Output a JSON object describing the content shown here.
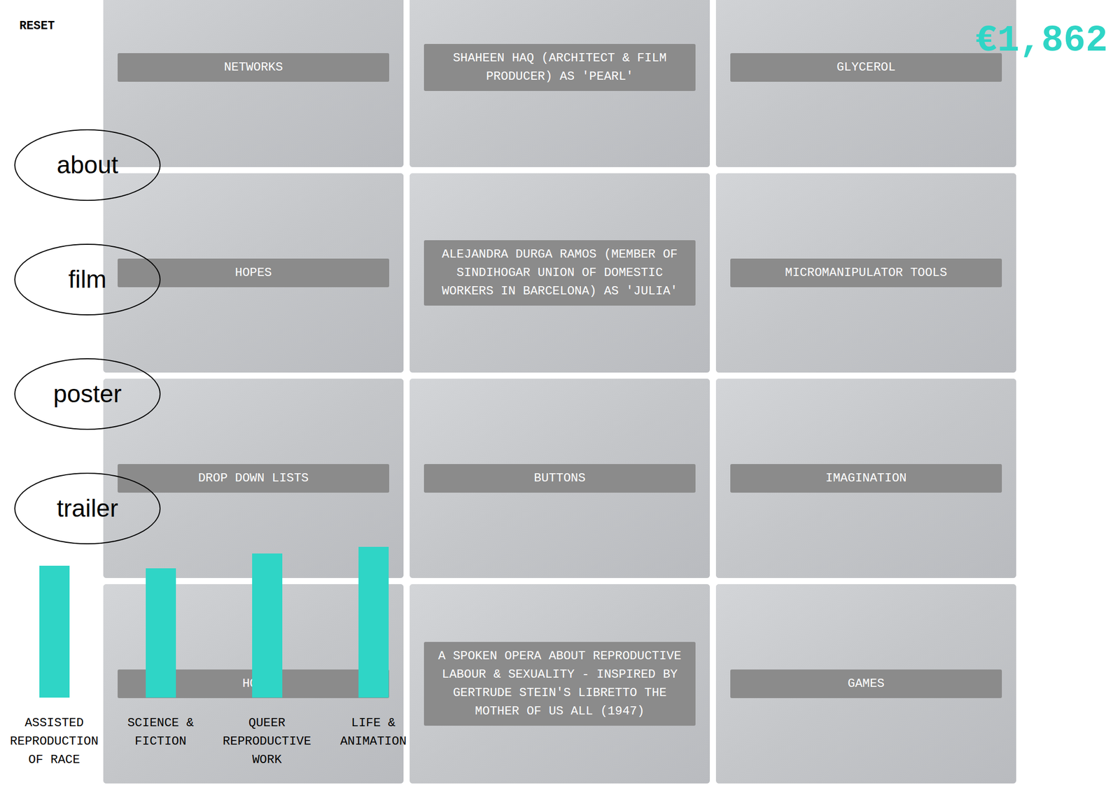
{
  "reset": "RESET",
  "price": "€1,862",
  "nav": [
    {
      "label": "about"
    },
    {
      "label": "film"
    },
    {
      "label": "poster"
    },
    {
      "label": "trailer"
    }
  ],
  "cells": [
    {
      "label": "NETWORKS"
    },
    {
      "label": "SHAHEEN HAQ (ARCHITECT & FILM PRODUCER) AS 'PEARL'"
    },
    {
      "label": "GLYCEROL"
    },
    {
      "label": "HOPES"
    },
    {
      "label": "ALEJANDRA DURGA RAMOS (MEMBER OF SINDIHOGAR UNION OF DOMESTIC WORKERS IN BARCELONA) AS 'JULIA'"
    },
    {
      "label": "MICROMANIPULATOR TOOLS"
    },
    {
      "label": "DROP DOWN LISTS"
    },
    {
      "label": "BUTTONS"
    },
    {
      "label": "IMAGINATION"
    },
    {
      "label": "HOM"
    },
    {
      "label": "A SPOKEN OPERA ABOUT REPRODUCTIVE LABOUR & SEXUALITY - INSPIRED BY GERTRUDE STEIN'S LIBRETTO THE MOTHER OF US ALL (1947)"
    },
    {
      "label": "GAMES"
    }
  ],
  "chart": {
    "bars": [
      {
        "label": "ASSISTED REPRODUCTION OF RACE",
        "value": 258
      },
      {
        "label": "SCIENCE & FICTION",
        "value": 253
      },
      {
        "label": "QUEER REPRODUCTIVE WORK",
        "value": 282
      },
      {
        "label": "LIFE & ANIMATION",
        "value": 295
      }
    ]
  }
}
